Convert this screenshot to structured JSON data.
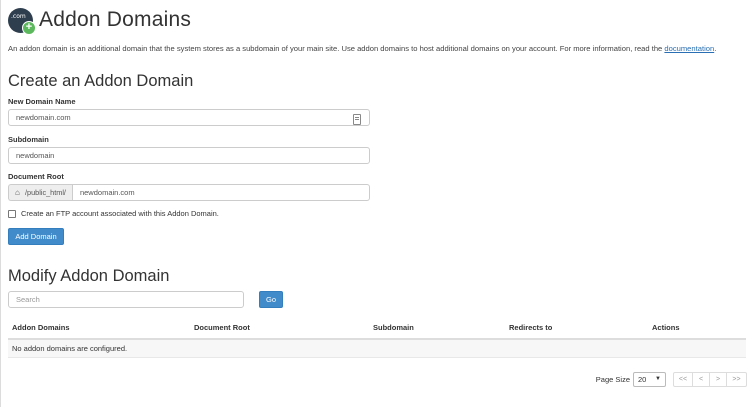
{
  "header": {
    "logo_text": ".com",
    "title": "Addon Domains"
  },
  "description": {
    "text": "An addon domain is an additional domain that the system stores as a subdomain of your main site. Use addon domains to host additional domains on your account. For more information, read the ",
    "link": "documentation",
    "end": "."
  },
  "create_section": {
    "title": "Create an Addon Domain",
    "new_domain_label": "New Domain Name",
    "new_domain_placeholder": "newdomain.com",
    "subdomain_label": "Subdomain",
    "subdomain_placeholder": "newdomain",
    "doc_root_label": "Document Root",
    "doc_root_prefix": "/public_html/",
    "doc_root_placeholder": "newdomain.com",
    "ftp_checkbox_label": "Create an FTP account associated with this Addon Domain.",
    "ftp_checked": false,
    "add_button": "Add Domain"
  },
  "modify_section": {
    "title": "Modify Addon Domain",
    "search_placeholder": "Search",
    "go_button": "Go"
  },
  "table": {
    "columns": [
      "Addon Domains",
      "Document Root",
      "Subdomain",
      "Redirects to",
      "Actions"
    ],
    "empty_message": "No addon domains are configured."
  },
  "pagination": {
    "page_size_label": "Page Size",
    "page_size_value": "20",
    "first": "<<",
    "prev": "<",
    "next": ">",
    "last": ">>"
  },
  "colors": {
    "primary_button": "#428bca",
    "link": "#2a6fb3",
    "logo_bg": "#2e3e4e",
    "logo_plus": "#5cb85c"
  },
  "icons": [
    "domain-plus-icon",
    "home-icon",
    "contact-card-icon",
    "chevron-down-icon"
  ]
}
